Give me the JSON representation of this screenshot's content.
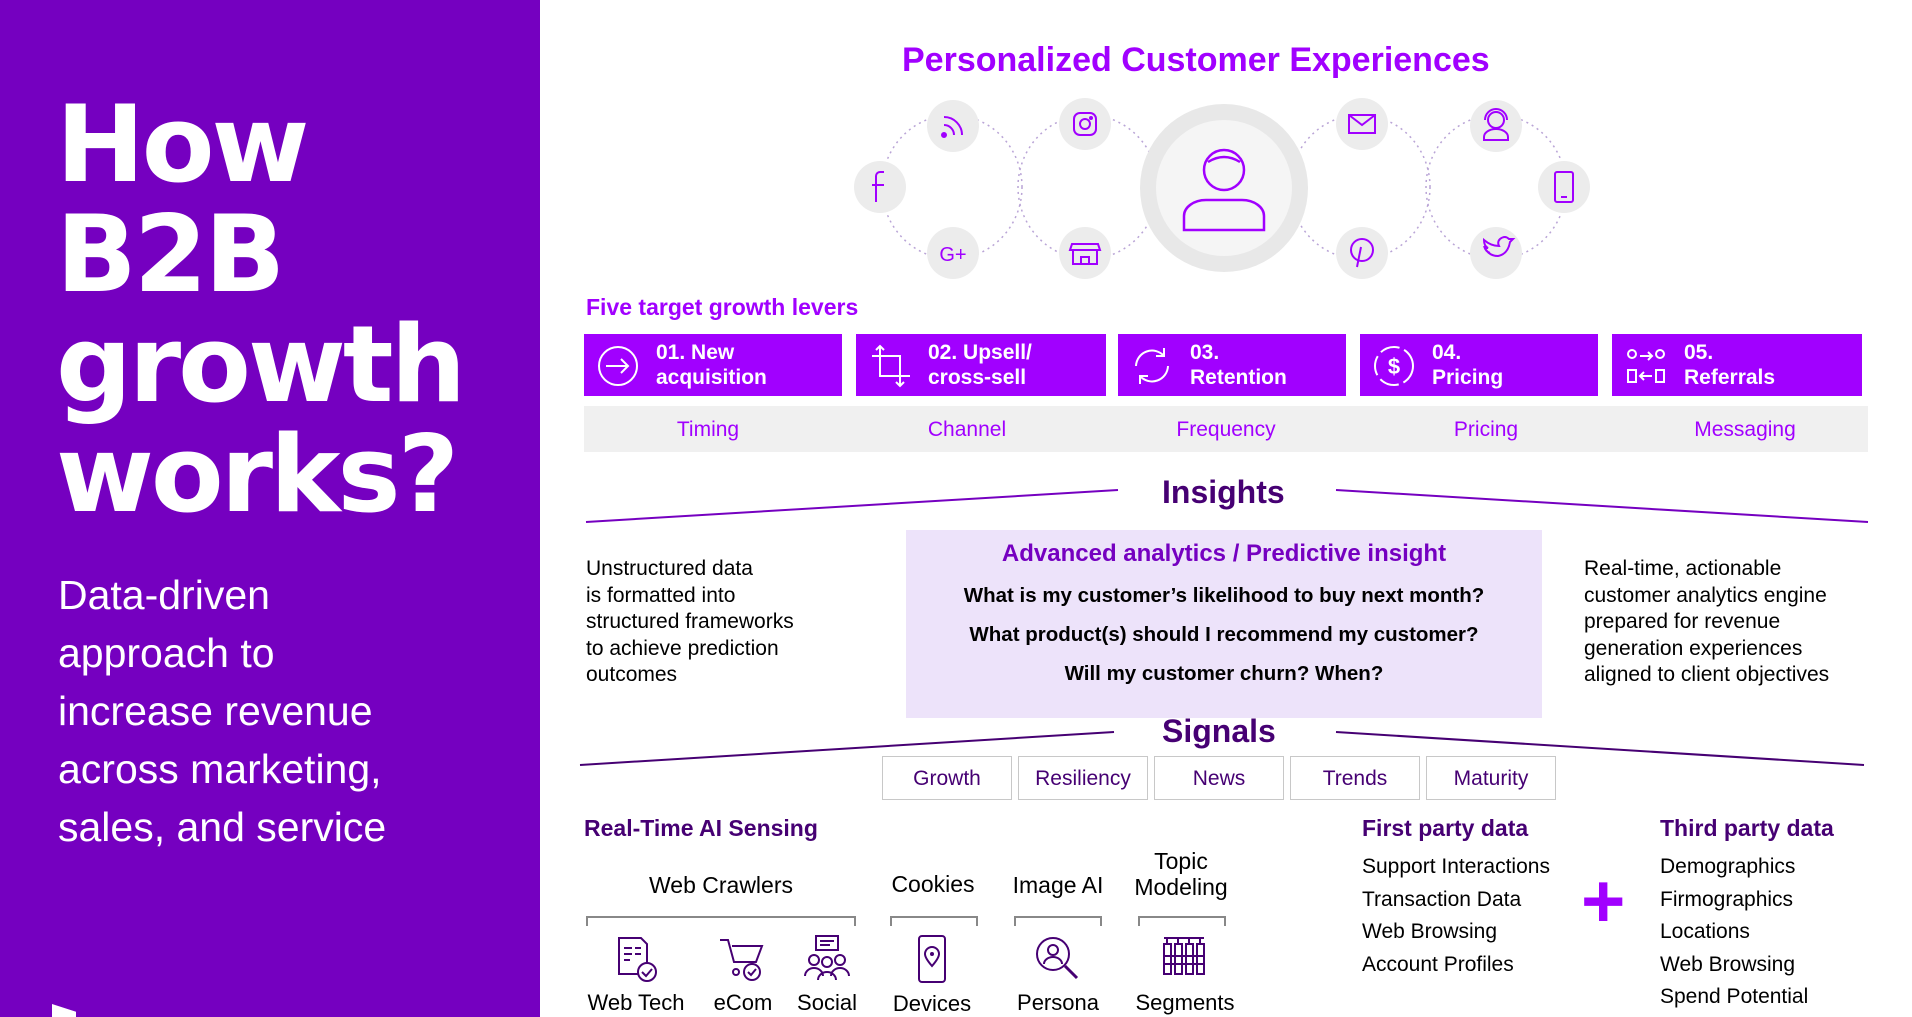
{
  "left": {
    "title_lines": [
      "How",
      "B2B",
      "growth",
      "works?"
    ],
    "subtitle_lines": [
      "Data-driven",
      "approach to",
      "increase revenue",
      "across marketing,",
      "sales, and service"
    ]
  },
  "header": {
    "title": "Personalized Customer Experiences"
  },
  "channel_icons": [
    "rss-icon",
    "instagram-icon",
    "facebook-icon",
    "google-plus-icon",
    "store-icon",
    "customer-avatar-icon",
    "mail-icon",
    "support-agent-icon",
    "mobile-phone-icon",
    "pinterest-icon",
    "twitter-icon"
  ],
  "levers": {
    "heading": "Five target growth levers",
    "items": [
      {
        "label": "01. New\nacquisition",
        "icon": "enter-arrow-icon"
      },
      {
        "label": "02. Upsell/\ncross-sell",
        "icon": "crop-arrows-icon"
      },
      {
        "label": "03.\nRetention",
        "icon": "refresh-cycle-icon"
      },
      {
        "label": "04.\nPricing",
        "icon": "dollar-cycle-icon"
      },
      {
        "label": "05.\nReferrals",
        "icon": "referral-arrows-icon"
      }
    ],
    "attributes": [
      "Timing",
      "Channel",
      "Frequency",
      "Pricing",
      "Messaging"
    ]
  },
  "insights": {
    "heading": "Insights",
    "box_title": "Advanced analytics / Predictive insight",
    "questions": [
      "What is my customer’s likelihood to buy next month?",
      "What product(s) should I recommend my customer?",
      "Will my customer churn? When?"
    ],
    "left_lines": [
      "Unstructured data",
      "is formatted into",
      "structured frameworks",
      "to achieve prediction",
      "outcomes"
    ],
    "right_lines": [
      "Real-time, actionable",
      "customer analytics engine",
      "prepared for revenue",
      "generation experiences",
      "aligned to client objectives"
    ]
  },
  "signals": {
    "heading": "Signals",
    "items": [
      "Growth",
      "Resiliency",
      "News",
      "Trends",
      "Maturity"
    ]
  },
  "sensing": {
    "heading": "Real-Time AI Sensing",
    "categories": [
      "Web Crawlers",
      "Cookies",
      "Image AI",
      "Topic\nModeling"
    ],
    "sources": [
      {
        "label": "Web Tech",
        "icon": "web-tech-icon"
      },
      {
        "label": "eCom",
        "icon": "shopping-cart-icon"
      },
      {
        "label": "Social",
        "icon": "social-group-icon"
      },
      {
        "label": "Devices",
        "icon": "device-location-icon"
      },
      {
        "label": "Persona",
        "icon": "persona-search-icon"
      },
      {
        "label": "Segments",
        "icon": "segments-icon"
      }
    ]
  },
  "first_party": {
    "heading": "First party data",
    "items": [
      "Support Interactions",
      "Transaction Data",
      "Web Browsing",
      "Account Profiles"
    ]
  },
  "plus": "+",
  "third_party": {
    "heading": "Third party data",
    "items": [
      "Demographics",
      "Firmographics",
      "Locations",
      "Web Browsing",
      "Spend Potential"
    ]
  },
  "colors": {
    "primary": "#a100ff",
    "panel": "#7500c0",
    "dark": "#460073",
    "light_bg": "#f0f0f0",
    "box_bg": "#ede3fa"
  }
}
